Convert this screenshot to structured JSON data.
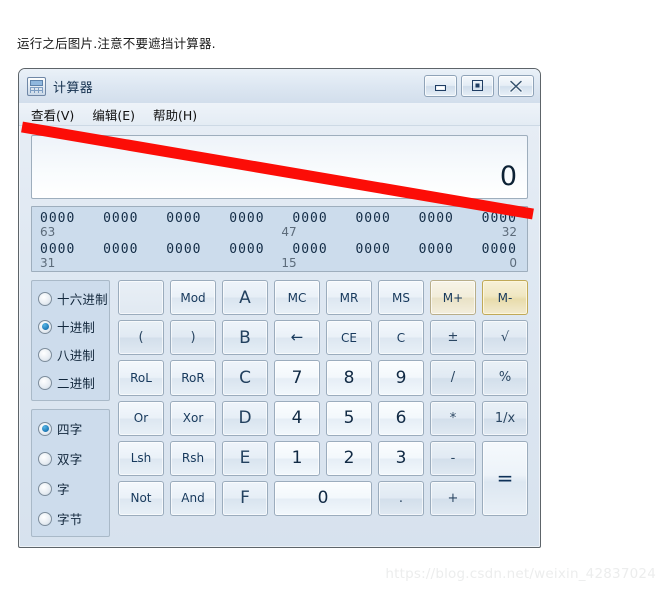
{
  "caption": "运行之后图片.注意不要遮挡计算器.",
  "window": {
    "title": "计算器",
    "icon": "calculator-icon",
    "controls": {
      "minimize": "minimize-icon",
      "maximize": "maximize-icon",
      "close": "close-icon"
    }
  },
  "menu": {
    "items": [
      {
        "label": "查看(V)"
      },
      {
        "label": "编辑(E)"
      },
      {
        "label": "帮助(H)"
      }
    ]
  },
  "display": {
    "value": "0"
  },
  "bits": {
    "row1": {
      "groups": [
        "0000",
        "0000",
        "0000",
        "0000",
        "0000",
        "0000",
        "0000",
        "0000"
      ],
      "label_left": "63",
      "label_mid": "47",
      "label_right": "32"
    },
    "row2": {
      "groups": [
        "0000",
        "0000",
        "0000",
        "0000",
        "0000",
        "0000",
        "0000",
        "0000"
      ],
      "label_left": "31",
      "label_mid": "15",
      "label_right": "0"
    }
  },
  "number_base": {
    "options": [
      {
        "label": "十六进制",
        "selected": false
      },
      {
        "label": "十进制",
        "selected": true
      },
      {
        "label": "八进制",
        "selected": false
      },
      {
        "label": "二进制",
        "selected": false
      }
    ]
  },
  "word_size": {
    "options": [
      {
        "label": "四字",
        "selected": true
      },
      {
        "label": "双字",
        "selected": false
      },
      {
        "label": "字",
        "selected": false
      },
      {
        "label": "字节",
        "selected": false
      }
    ]
  },
  "keypad": {
    "rows": [
      [
        "",
        "Mod",
        "A",
        "MC",
        "MR",
        "MS",
        "M+",
        "M-"
      ],
      [
        "(",
        ")",
        "B",
        "←",
        "CE",
        "C",
        "±",
        "√"
      ],
      [
        "RoL",
        "RoR",
        "C",
        "7",
        "8",
        "9",
        "/",
        "%"
      ],
      [
        "Or",
        "Xor",
        "D",
        "4",
        "5",
        "6",
        "*",
        "1/x"
      ],
      [
        "Lsh",
        "Rsh",
        "E",
        "1",
        "2",
        "3",
        "-",
        "="
      ],
      [
        "Not",
        "And",
        "F",
        "0",
        ".",
        "+"
      ]
    ]
  },
  "annotation": {
    "stroke_color": "#fc0d07"
  },
  "watermark": "https://blog.csdn.net/weixin_42837024"
}
